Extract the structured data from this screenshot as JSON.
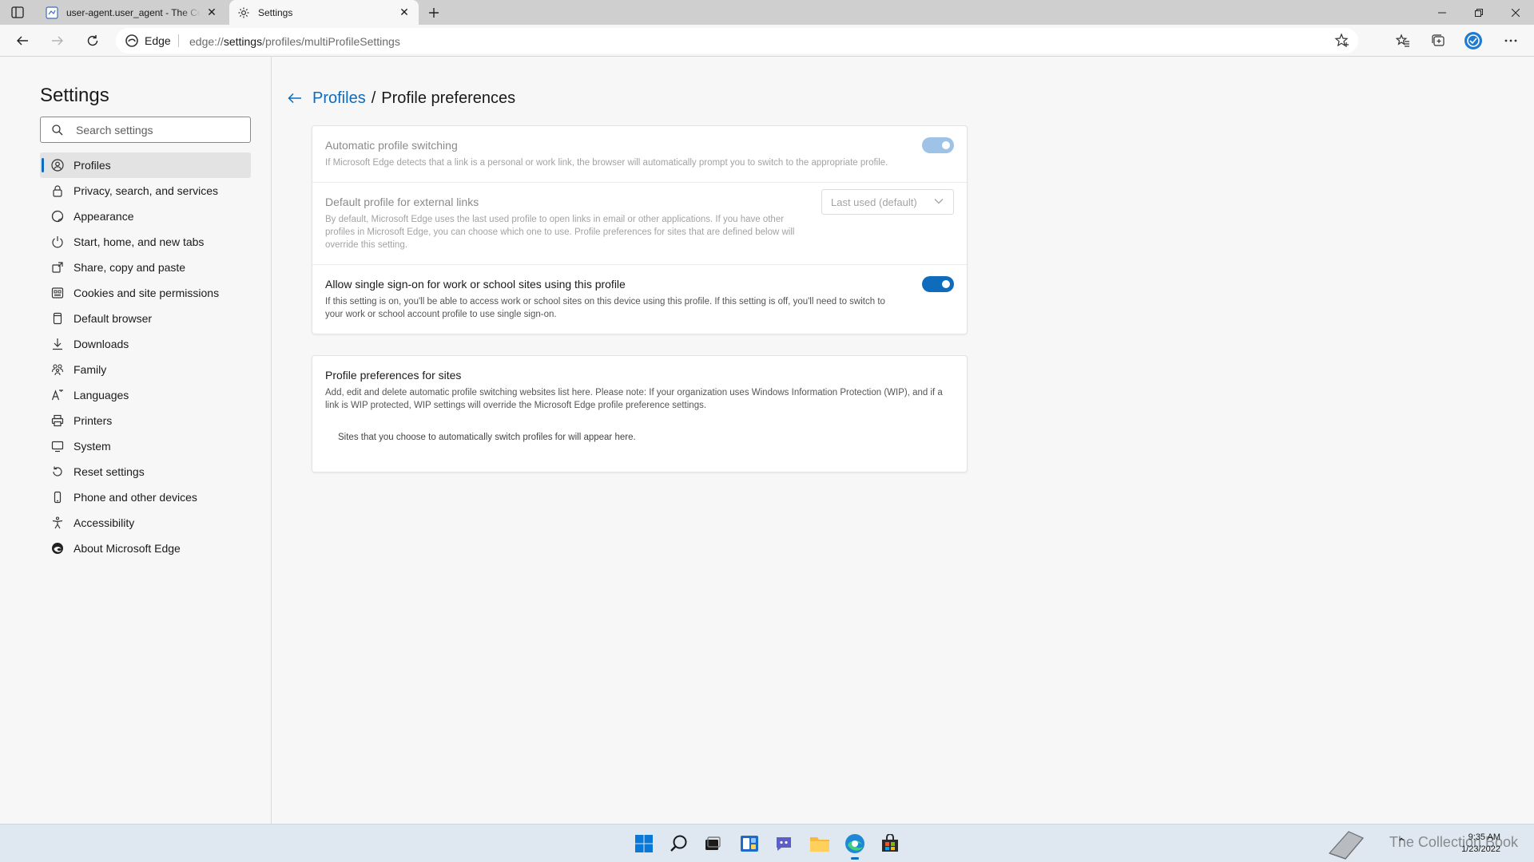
{
  "browser": {
    "tabs": [
      {
        "title": "user-agent.user_agent - The Coll",
        "active": false
      },
      {
        "title": "Settings",
        "active": true
      }
    ],
    "address": {
      "chip_label": "Edge",
      "url_scheme": "edge://",
      "url_host": "settings",
      "url_path": "/profiles/multiProfileSettings"
    }
  },
  "sidebar": {
    "title": "Settings",
    "search_placeholder": "Search settings",
    "items": [
      {
        "label": "Profiles",
        "icon": "profile-icon",
        "selected": true
      },
      {
        "label": "Privacy, search, and services",
        "icon": "lock-icon"
      },
      {
        "label": "Appearance",
        "icon": "appearance-icon"
      },
      {
        "label": "Start, home, and new tabs",
        "icon": "power-icon"
      },
      {
        "label": "Share, copy and paste",
        "icon": "share-icon"
      },
      {
        "label": "Cookies and site permissions",
        "icon": "cookies-icon"
      },
      {
        "label": "Default browser",
        "icon": "browser-icon"
      },
      {
        "label": "Downloads",
        "icon": "download-icon"
      },
      {
        "label": "Family",
        "icon": "family-icon"
      },
      {
        "label": "Languages",
        "icon": "language-icon"
      },
      {
        "label": "Printers",
        "icon": "printer-icon"
      },
      {
        "label": "System",
        "icon": "system-icon"
      },
      {
        "label": "Reset settings",
        "icon": "reset-icon"
      },
      {
        "label": "Phone and other devices",
        "icon": "phone-icon"
      },
      {
        "label": "Accessibility",
        "icon": "accessibility-icon"
      },
      {
        "label": "About Microsoft Edge",
        "icon": "edge-logo-icon"
      }
    ]
  },
  "main": {
    "breadcrumb_parent": "Profiles",
    "breadcrumb_separator": "/",
    "breadcrumb_current": "Profile preferences",
    "settings": {
      "auto_switch": {
        "title": "Automatic profile switching",
        "desc": "If Microsoft Edge detects that a link is a personal or work link, the browser will automatically prompt you to switch to the appropriate profile.",
        "enabled": true,
        "disabled_state": true
      },
      "default_profile": {
        "title": "Default profile for external links",
        "desc": "By default, Microsoft Edge uses the last used profile to open links in email or other applications. If you have other profiles in Microsoft Edge, you can choose which one to use. Profile preferences for sites that are defined below will override this setting.",
        "dropdown_value": "Last used (default)"
      },
      "sso": {
        "title": "Allow single sign-on for work or school sites using this profile",
        "desc": "If this setting is on, you'll be able to access work or school sites on this device using this profile. If this setting is off, you'll need to switch to your work or school account profile to use single sign-on.",
        "enabled": true
      }
    },
    "sites": {
      "title": "Profile preferences for sites",
      "desc": "Add, edit and delete automatic profile switching websites list here. Please note: If your organization uses Windows Information Protection (WIP), and if a link is WIP protected, WIP settings will override the Microsoft Edge profile preference settings.",
      "empty_text": "Sites that you choose to automatically switch profiles for will appear here."
    }
  },
  "taskbar": {
    "icons": [
      "windows-start-icon",
      "search-icon",
      "task-view-icon",
      "widgets-icon",
      "chat-icon",
      "file-explorer-icon",
      "edge-icon",
      "store-icon"
    ],
    "time": "9:35 AM",
    "date": "1/23/2022",
    "watermark": "The Collection Book"
  },
  "colors": {
    "accent": "#0f6cbd",
    "toggle_disabled": "#9ec3e6",
    "tabstrip_bg": "#cfcfcf",
    "page_bg": "#f7f7f7"
  }
}
